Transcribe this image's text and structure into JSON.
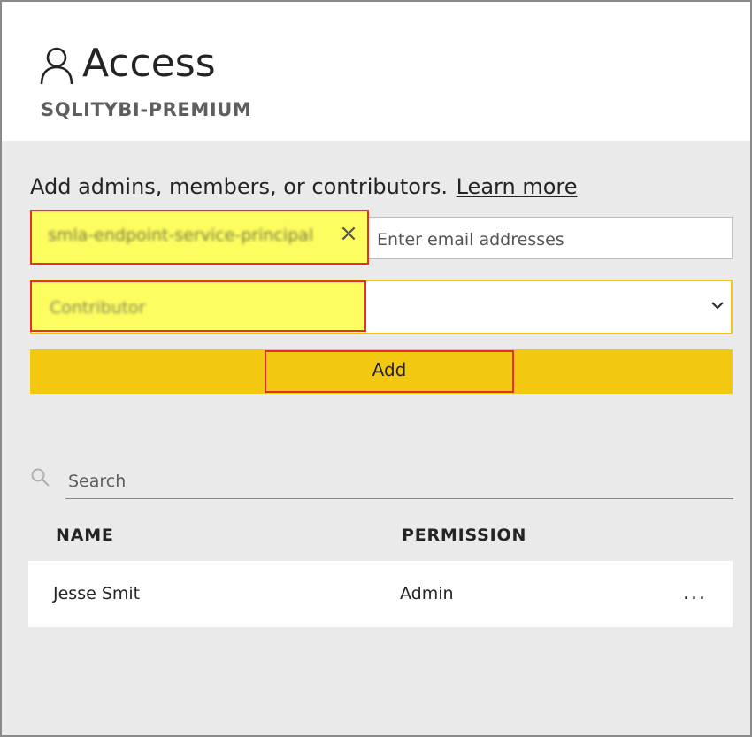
{
  "header": {
    "title": "Access",
    "subtitle": "SQLITYBI-PREMIUM"
  },
  "intro": {
    "text": "Add admins, members, or contributors.",
    "learn_more": "Learn more"
  },
  "email": {
    "chip_value": "smla-endpoint-service-principal",
    "placeholder": "Enter email addresses"
  },
  "role": {
    "selected": "Contributor"
  },
  "add_button": {
    "label": "Add"
  },
  "search": {
    "placeholder": "Search"
  },
  "table": {
    "columns": [
      "NAME",
      "PERMISSION"
    ],
    "rows": [
      {
        "name": "Jesse Smit",
        "permission": "Admin",
        "more": "..."
      }
    ]
  },
  "colors": {
    "accent": "#f2c811",
    "highlight": "#fdfd60",
    "annotation": "#e2302c"
  }
}
